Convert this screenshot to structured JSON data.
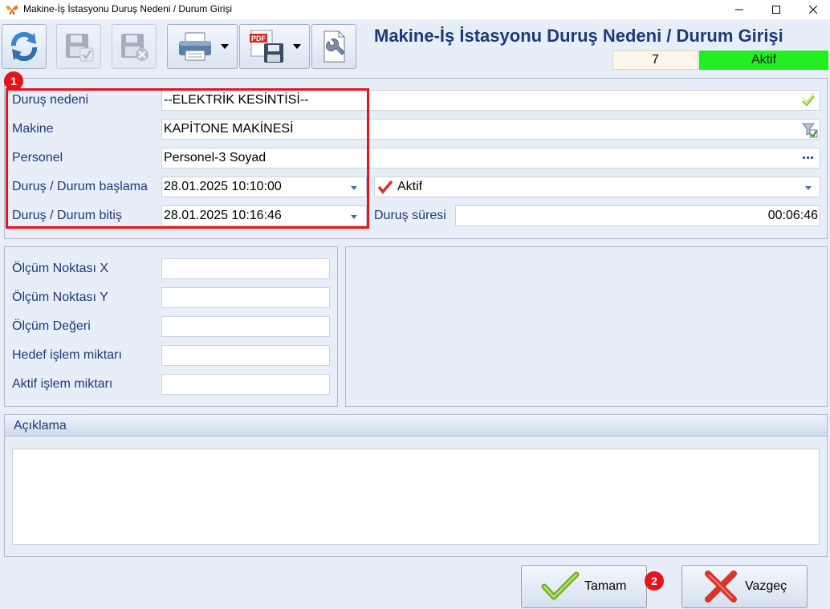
{
  "window": {
    "title": "Makine-İş İstasyonu Duruş Nedeni / Durum Girişi"
  },
  "toolbar": {
    "buttons": [
      {
        "name": "refresh-button",
        "icon": "refresh-icon"
      },
      {
        "name": "save-button",
        "icon": "save-check-icon",
        "enabled": false
      },
      {
        "name": "delete-button",
        "icon": "save-delete-icon",
        "enabled": false
      },
      {
        "name": "print-button",
        "icon": "printer-icon",
        "dropdown": true
      },
      {
        "name": "export-pdf-button",
        "icon": "pdf-save-icon",
        "dropdown": true
      },
      {
        "name": "settings-button",
        "icon": "document-wrench-icon"
      }
    ]
  },
  "header": {
    "title": "Makine-İş İstasyonu Duruş Nedeni / Durum Girişi",
    "record_no": "7",
    "status": "Aktif",
    "status_color": "#22ee22"
  },
  "form": {
    "reason_label": "Duruş nedeni",
    "reason_value": "--ELEKTRİK KESİNTİSİ--",
    "machine_label": "Makine",
    "machine_value": "KAPİTONE MAKİNESİ",
    "personnel_label": "Personel",
    "personnel_value": "Personel-3 Soyad",
    "start_label": "Duruş / Durum başlama",
    "start_value": "28.01.2025 10:10:00",
    "status_select_value": "Aktif",
    "end_label": "Duruş / Durum bitiş",
    "end_value": "28.01.2025 10:16:46",
    "duration_label": "Duruş süresi",
    "duration_value": "00:06:46"
  },
  "measurements": {
    "x_label": "Ölçüm Noktası X",
    "y_label": "Ölçüm Noktası Y",
    "value_label": "Ölçüm Değeri",
    "target_label": "Hedef işlem miktarı",
    "actual_label": "Aktif işlem miktarı"
  },
  "notes": {
    "title": "Açıklama",
    "value": ""
  },
  "buttons": {
    "ok_label": "Tamam",
    "cancel_label": "Vazgeç"
  },
  "annotations": {
    "marker_1": "1",
    "marker_2": "2",
    "highlight_color": "#e8141c"
  }
}
